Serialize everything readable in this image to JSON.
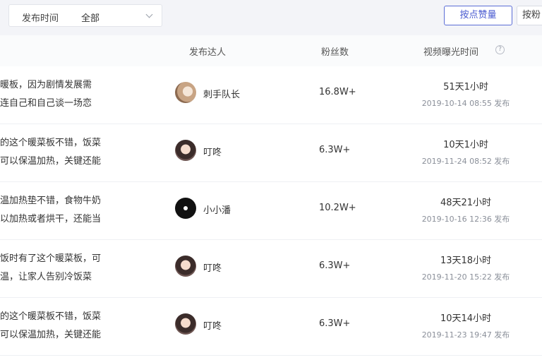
{
  "filter": {
    "label": "发布时间",
    "value": "全部"
  },
  "sort": {
    "active_label": "按点赞量",
    "next_label": "按粉"
  },
  "table": {
    "columns": {
      "influencer": "发布达人",
      "fans": "粉丝数",
      "exposure_time": "视频曝光时间"
    },
    "rows": [
      {
        "desc_line1": "暖板，因为剧情发展需",
        "desc_line2": "连自己和自己谈一场恋",
        "influencer": "刺手队长",
        "avatar": "avatar-a",
        "fans": "16.8W+",
        "duration": "51天1小时",
        "published": "2019-10-14 08:55 发布"
      },
      {
        "desc_line1": "的这个暖菜板不错，饭菜",
        "desc_line2": "可以保温加热，关键还能",
        "influencer": "叮咚",
        "avatar": "avatar-b",
        "fans": "6.3W+",
        "duration": "10天1小时",
        "published": "2019-11-24 08:52 发布"
      },
      {
        "desc_line1": "温加热垫不错，食物牛奶",
        "desc_line2": "以加热或者烘干，还能当",
        "influencer": "小小潘",
        "avatar": "avatar-c",
        "fans": "10.2W+",
        "duration": "48天21小时",
        "published": "2019-10-16 12:36 发布"
      },
      {
        "desc_line1": "饭时有了这个暖菜板，可",
        "desc_line2": "温，让家人告别冷饭菜",
        "influencer": "叮咚",
        "avatar": "avatar-b",
        "fans": "6.3W+",
        "duration": "13天18小时",
        "published": "2019-11-20 15:22 发布"
      },
      {
        "desc_line1": "的这个暖菜板不错，饭菜",
        "desc_line2": "可以保温加热，关键还能",
        "influencer": "叮咚",
        "avatar": "avatar-b",
        "fans": "6.3W+",
        "duration": "10天14小时",
        "published": "2019-11-23 19:47 发布"
      }
    ]
  }
}
